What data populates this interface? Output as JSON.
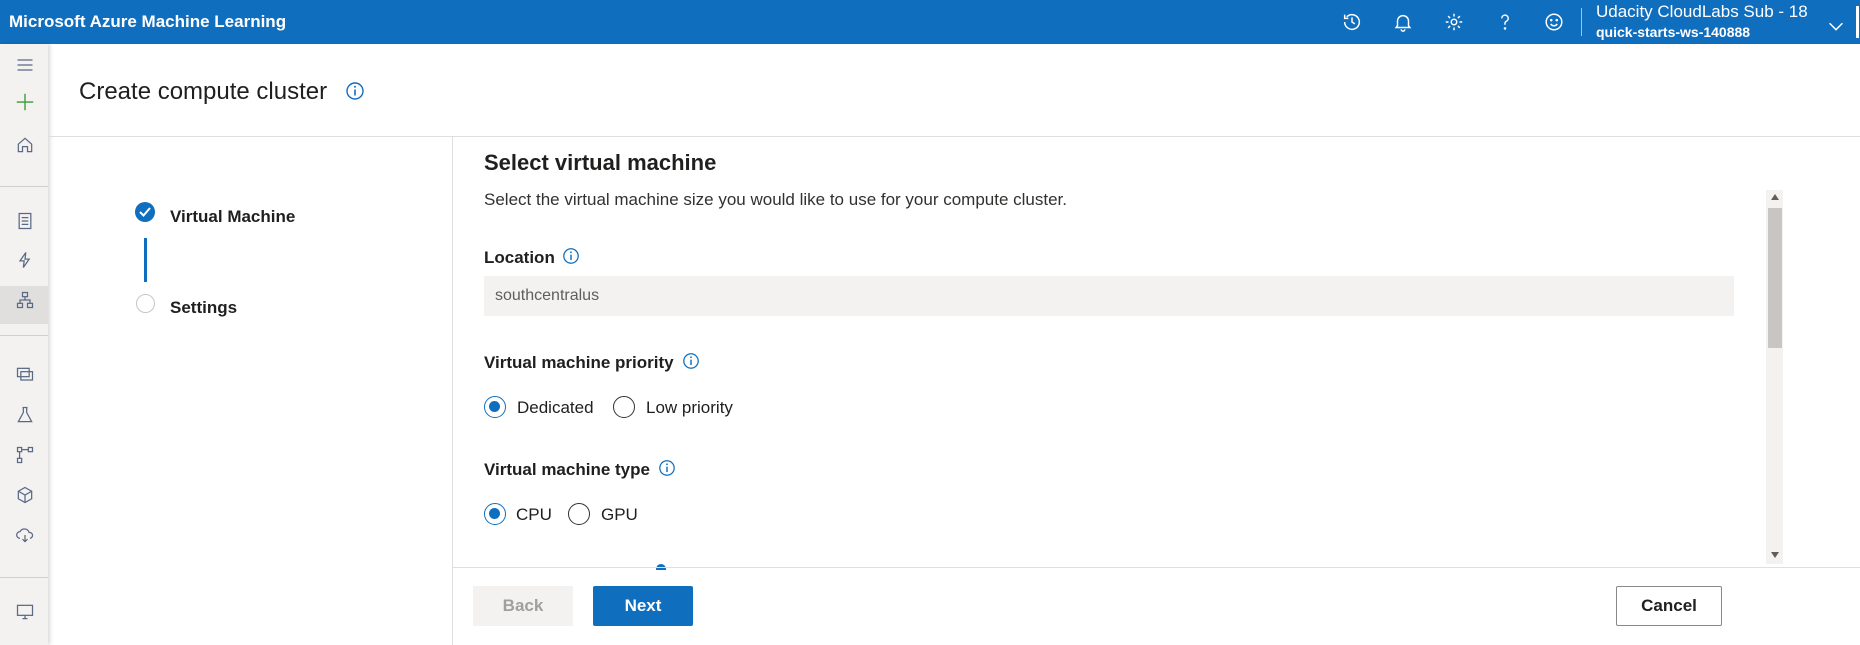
{
  "topbar": {
    "brand": "Microsoft Azure Machine Learning",
    "account_name": "Udacity CloudLabs Sub - 18",
    "workspace": "quick-starts-ws-140888",
    "icons": [
      "history-icon",
      "bell-icon",
      "gear-icon",
      "help-icon",
      "smiley-icon",
      "chevron-down-icon"
    ]
  },
  "leftnav": {
    "icons": [
      "hamburger-icon",
      "plus-icon",
      "home-icon",
      "notebook-icon",
      "automl-icon",
      "designer-icon",
      "datasets-icon",
      "experiments-icon",
      "pipelines-icon",
      "models-icon",
      "endpoints-icon",
      "compute-icon"
    ]
  },
  "page": {
    "title": "Create compute cluster"
  },
  "stepper": {
    "steps": [
      {
        "label": "Virtual Machine",
        "state": "completed"
      },
      {
        "label": "Settings",
        "state": "pending"
      }
    ]
  },
  "form": {
    "section_title": "Select virtual machine",
    "section_desc": "Select the virtual machine size you would like to use for your compute cluster.",
    "location": {
      "label": "Location",
      "value": "southcentralus"
    },
    "priority": {
      "label": "Virtual machine priority",
      "options": [
        {
          "label": "Dedicated",
          "selected": true
        },
        {
          "label": "Low priority",
          "selected": false
        }
      ]
    },
    "vm_type": {
      "label": "Virtual machine type",
      "options": [
        {
          "label": "CPU",
          "selected": true
        },
        {
          "label": "GPU",
          "selected": false
        }
      ]
    }
  },
  "footer": {
    "back_label": "Back",
    "next_label": "Next",
    "cancel_label": "Cancel"
  },
  "colors": {
    "accent": "#106ebe",
    "nav_bg": "#f3f2f1"
  }
}
